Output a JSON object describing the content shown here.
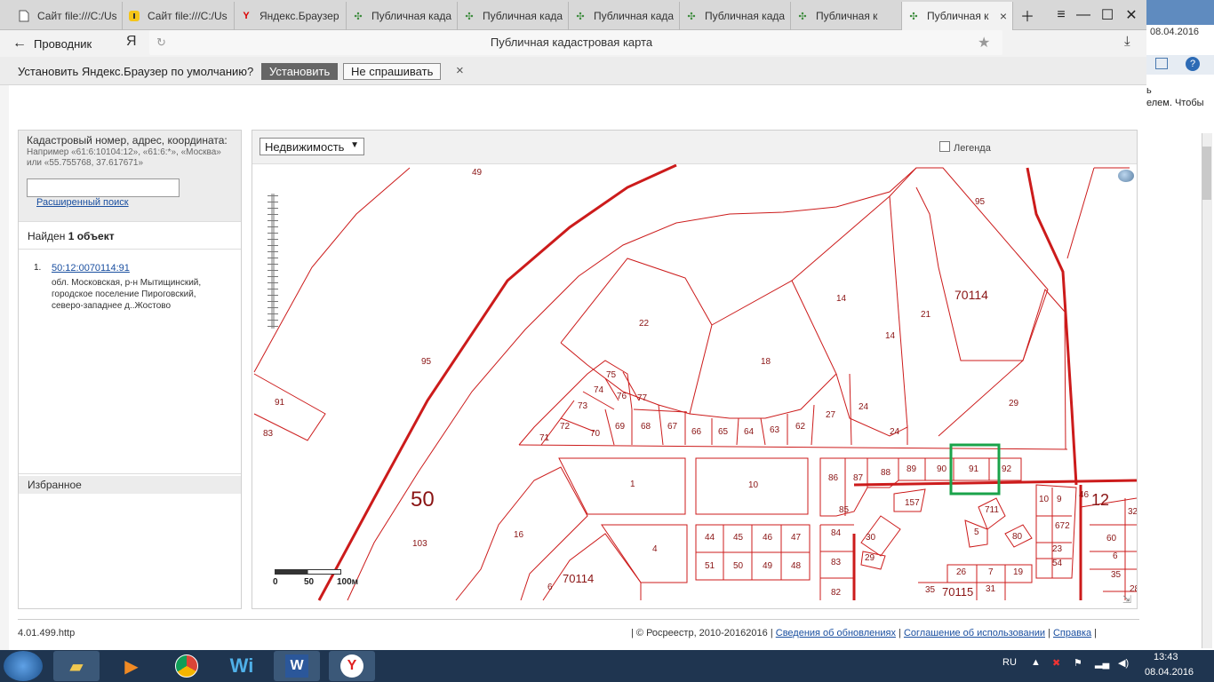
{
  "browser": {
    "tabs": [
      {
        "label": "Сайт file:///C:/Us",
        "icon": "page-icon"
      },
      {
        "label": "Сайт file:///C:/Us",
        "icon": "yandex-shield-icon"
      },
      {
        "label": "Яндекс.Браузер с",
        "icon": "yandex-y-icon"
      },
      {
        "label": "Публичная када",
        "icon": "rosreestr-icon"
      },
      {
        "label": "Публичная када",
        "icon": "rosreestr-icon"
      },
      {
        "label": "Публичная када",
        "icon": "rosreestr-icon"
      },
      {
        "label": "Публичная када",
        "icon": "rosreestr-icon"
      },
      {
        "label": "Публичная к",
        "icon": "rosreestr-icon"
      },
      {
        "label": "Публичная к",
        "icon": "rosreestr-icon"
      }
    ],
    "back_label": "Проводник",
    "yandex_logo": "Я",
    "page_title": "Публичная кадастровая карта",
    "notification": {
      "text": "Установить Яндекс.Браузер по умолчанию?",
      "install": "Установить",
      "dont_ask": "Не спрашивать",
      "close": "×"
    }
  },
  "search": {
    "heading": "Кадастровый номер, адрес, координата:",
    "hint": "Например «61:6:10104:12», «61:6:*», «Москва» или «55.755768, 37.617671»",
    "input_value": "",
    "advanced": "Расширенный поиск"
  },
  "results": {
    "found_prefix": "Найден",
    "found_count": "1 объект",
    "items": [
      {
        "num": "1.",
        "cadastral": "50:12:0070114:91",
        "address": "обл. Московская, р-н Мытищинский, городское поселение Пироговский, северо-западнее д..Жостово"
      }
    ]
  },
  "favorites": {
    "title": "Избранное"
  },
  "map": {
    "layer_select": "Недвижимость",
    "legend": "Легенда",
    "scale": {
      "l0": "0",
      "l1": "50",
      "l2": "100м"
    },
    "labels": {
      "block_main": "70114",
      "block_bottom": "70114",
      "block_70115": "70115",
      "region_50": "50",
      "region_12": "12",
      "p49": "49",
      "p95top": "95",
      "p95mid": "95",
      "p91l": "91",
      "p83l": "83",
      "p103": "103",
      "p22": "22",
      "p18": "18",
      "p14a": "14",
      "p14b": "14",
      "p21": "21",
      "p24a": "24",
      "p24b": "24",
      "p27": "27",
      "p29": "29",
      "p73": "73",
      "p74": "74",
      "p75": "75",
      "p76": "76",
      "p77": "77",
      "p72": "72",
      "p71": "71",
      "p70": "70",
      "p69": "69",
      "p68": "68",
      "p67": "67",
      "p66": "66",
      "p65": "65",
      "p64": "64",
      "p63": "63",
      "p62": "62",
      "p1": "1",
      "p10": "10",
      "p16": "16",
      "p4": "4",
      "p6": "6",
      "p44": "44",
      "p45": "45",
      "p46": "46",
      "p47": "47",
      "p51": "51",
      "p50": "50",
      "p49b": "49",
      "p48": "48",
      "p86": "86",
      "p87": "87",
      "p88": "88",
      "p89": "89",
      "p90": "90",
      "p91": "91",
      "p92": "92",
      "p85": "85",
      "p84": "84",
      "p83": "83",
      "p82": "82",
      "p157": "157",
      "p30": "30",
      "p29b": "29",
      "p711": "711",
      "p5": "5",
      "p80": "80",
      "p26": "26",
      "p7": "7",
      "p19": "19",
      "p35": "35",
      "p31": "31",
      "p10r": "10",
      "p9": "9",
      "p672": "672",
      "p46r": "46",
      "p23": "23",
      "p54": "54",
      "p60": "60",
      "p6r": "6",
      "p35r": "35",
      "p32": "32",
      "p28": "28"
    }
  },
  "footer": {
    "version": "4.01.499.http",
    "copyright": "© Росреестр, 2010-20162016",
    "link1": "Сведения об обновлениях",
    "link2": "Соглашение об использовании",
    "link3": "Справка"
  },
  "side_fragment": {
    "line1": "ь",
    "line2": "елем. Чтобы"
  },
  "taskbar": {
    "lang": "RU",
    "time": "13:43",
    "date": "08.04.2016",
    "top_clock": "08.04.2016"
  },
  "colors": {
    "parcel": "#cc1b1b",
    "selection": "#1aa34a",
    "link": "#1a4fa0"
  }
}
